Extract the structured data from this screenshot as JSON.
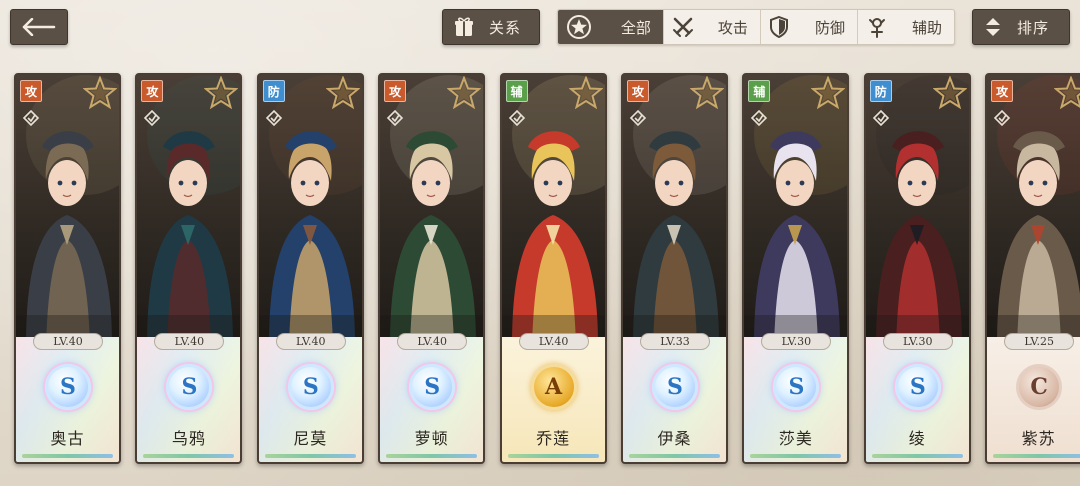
{
  "header": {
    "back_icon": "back-arrow-icon",
    "relation": {
      "label": "关系",
      "icon": "gift-box-icon"
    },
    "sort": {
      "label": "排序",
      "icon": "sort-arrows-icon"
    }
  },
  "filters": [
    {
      "key": "all",
      "label": "全部",
      "icon": "star-badge-icon",
      "active": true
    },
    {
      "key": "attack",
      "label": "攻击",
      "icon": "crossed-swords-icon",
      "active": false
    },
    {
      "key": "defense",
      "label": "防御",
      "icon": "shield-icon",
      "active": false
    },
    {
      "key": "support",
      "label": "辅助",
      "icon": "support-icon",
      "active": false
    }
  ],
  "role_colors": {
    "攻": "#c95a2b",
    "防": "#3f8fd0",
    "辅": "#5aa04a"
  },
  "characters": [
    {
      "name": "奥古",
      "role": "攻",
      "level": "LV.40",
      "rank": "S",
      "palette": [
        "#3a3f47",
        "#7b6a54",
        "#b4a37f"
      ]
    },
    {
      "name": "乌鸦",
      "role": "攻",
      "level": "LV.40",
      "rank": "S",
      "palette": [
        "#1f3a44",
        "#5a2a2a",
        "#2e6a6a"
      ]
    },
    {
      "name": "尼莫",
      "role": "防",
      "level": "LV.40",
      "rank": "S",
      "palette": [
        "#23416a",
        "#c9a46a",
        "#8a5a3c"
      ]
    },
    {
      "name": "萝顿",
      "role": "攻",
      "level": "LV.40",
      "rank": "S",
      "palette": [
        "#2d4a34",
        "#d8c7a3",
        "#e9e3d1"
      ]
    },
    {
      "name": "乔莲",
      "role": "辅",
      "level": "LV.40",
      "rank": "A",
      "palette": [
        "#c63a2c",
        "#e9c45a",
        "#f4e3a6"
      ]
    },
    {
      "name": "伊桑",
      "role": "攻",
      "level": "LV.33",
      "rank": "S",
      "palette": [
        "#2f3b3f",
        "#7d5a3a",
        "#d9d1c0"
      ]
    },
    {
      "name": "莎美",
      "role": "辅",
      "level": "LV.30",
      "rank": "S",
      "palette": [
        "#3e3a5e",
        "#e8e3ee",
        "#c8a24c"
      ]
    },
    {
      "name": "绫",
      "role": "防",
      "level": "LV.30",
      "rank": "S",
      "palette": [
        "#4a1f1f",
        "#b23030",
        "#1c1c24"
      ]
    },
    {
      "name": "紫苏",
      "role": "攻",
      "level": "LV.25",
      "rank": "C",
      "palette": [
        "#6a5a4a",
        "#c9b8a0",
        "#b4432e"
      ]
    }
  ]
}
